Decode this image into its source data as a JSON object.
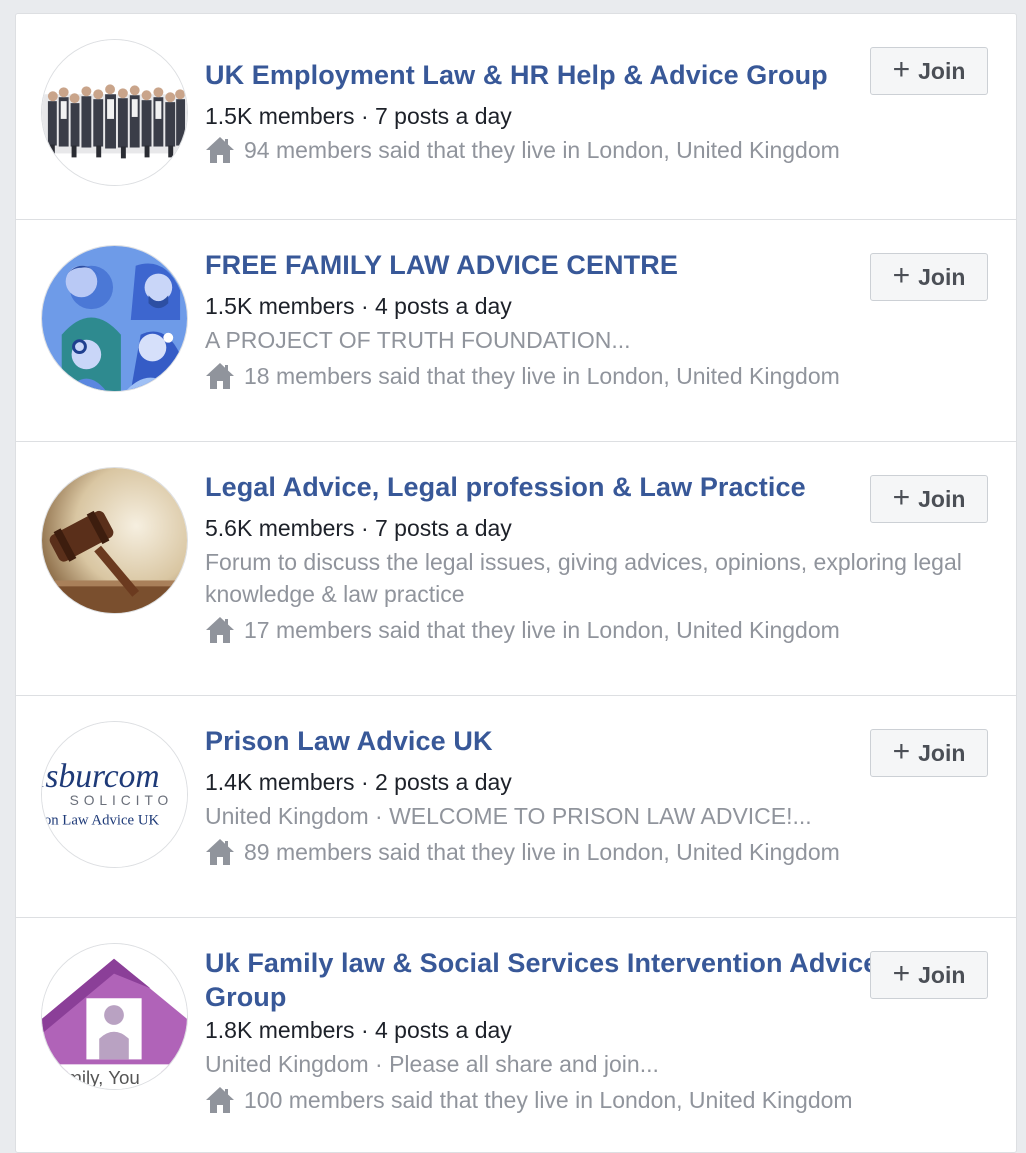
{
  "join_label": "Join",
  "join_plus": "+",
  "groups": [
    {
      "name": "UK Employment Law & HR Help & Advice Group",
      "stats": "1.5K members · 7 posts a day",
      "location": "94 members said that they live in London, United Kingdom"
    },
    {
      "name": "FREE FAMILY LAW ADVICE CENTRE",
      "stats": "1.5K members · 4 posts a day",
      "description": "A PROJECT OF TRUTH FOUNDATION...",
      "location": "18 members said that they live in London, United Kingdom"
    },
    {
      "name": "Legal Advice, Legal profession & Law Practice",
      "stats": "5.6K members · 7 posts a day",
      "description": "Forum to discuss the legal issues, giving advices, opinions, exploring legal knowledge & law practice",
      "location": "17 members said that they live in London, United Kingdom"
    },
    {
      "name": "Prison Law Advice UK",
      "stats": "1.4K members · 2 posts a day",
      "description": "United Kingdom · WELCOME TO PRISON LAW ADVICE!...",
      "location": "89 members said that they live in London, United Kingdom",
      "avatar_text": [
        "lsburcom",
        "SOLICITO",
        "son Law Advice UK"
      ]
    },
    {
      "name": "Uk Family law & Social Services Intervention Advice Group",
      "stats": "1.8K members · 4 posts a day",
      "description": "United Kingdom · Please all share and join...",
      "location": "100 members said that they live in London, United Kingdom",
      "avatar_text": [
        "amily, You"
      ]
    }
  ],
  "colors": {
    "link": "#385898",
    "muted": "#90949c",
    "text": "#1d2129",
    "page_bg": "#e9ebee"
  }
}
